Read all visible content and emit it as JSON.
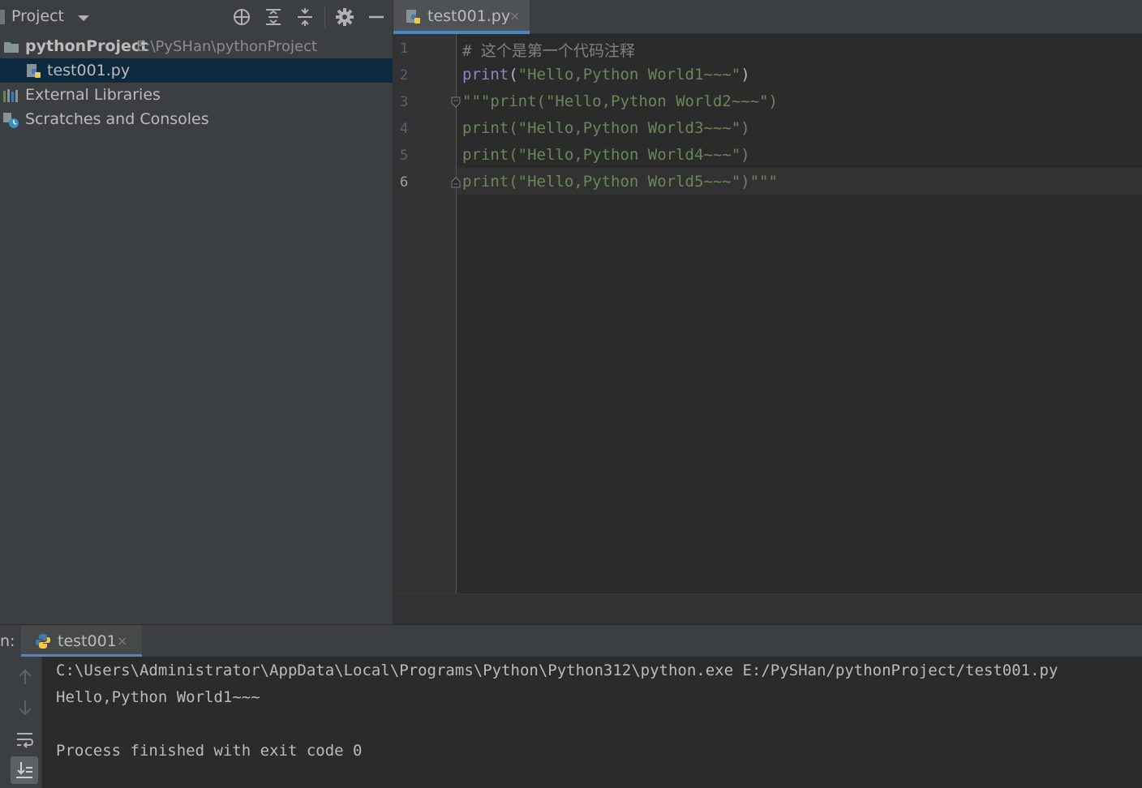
{
  "project_panel": {
    "title": "Project",
    "icons": [
      "crosshair-icon",
      "expand-all-icon",
      "collapse-all-icon",
      "gear-icon",
      "minimize-icon"
    ],
    "tree": {
      "root_name": "pythonProject",
      "root_path": "E:\\PySHan\\pythonProject",
      "file": "test001.py",
      "external_libraries": "External Libraries",
      "scratches": "Scratches and Consoles"
    }
  },
  "editor": {
    "tab_label": "test001.py",
    "tab_close": "×",
    "line_numbers": [
      "1",
      "2",
      "3",
      "4",
      "5",
      "6"
    ],
    "lines": [
      {
        "comment": "# 这个是第一个代码注释"
      },
      {
        "kw": "print",
        "open": "(",
        "str": "\"Hello,Python World1~~~\"",
        "close": ")"
      },
      {
        "str": "\"\"\"print(\"Hello,Python World2~~~\")"
      },
      {
        "str": "print(\"Hello,Python World3~~~\")"
      },
      {
        "str": "print(\"Hello,Python World4~~~\")"
      },
      {
        "str": "print(\"Hello,Python World5~~~\")\"\"\""
      }
    ],
    "current_line": 6
  },
  "run_panel": {
    "label": "n:",
    "tab_label": "test001",
    "tab_close": "×",
    "toolbar_icons": [
      "arrow-up-icon",
      "arrow-down-icon",
      "soft-wrap-icon",
      "scroll-to-end-icon"
    ],
    "console": [
      "C:\\Users\\Administrator\\AppData\\Local\\Programs\\Python\\Python312\\python.exe E:/PySHan/pythonProject/test001.py",
      "Hello,Python World1~~~",
      "",
      "Process finished with exit code 0"
    ]
  },
  "colors": {
    "accent": "#4a88c7",
    "keyword": "#8888c6",
    "string": "#6a8759",
    "comment": "#808080",
    "selection": "#0d293e"
  }
}
